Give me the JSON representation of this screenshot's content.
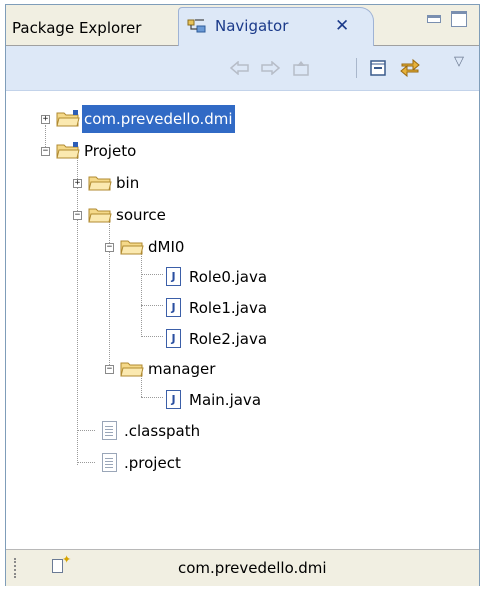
{
  "tabs": {
    "package_explorer": "Package Explorer",
    "navigator": "Navigator",
    "navigator_close": "✕"
  },
  "toolbar": {
    "back_icon": "back-arrow-icon",
    "forward_icon": "forward-arrow-icon",
    "up_icon": "go-up-icon",
    "collapse_icon": "collapse-all-icon",
    "link_icon": "link-with-editor-icon",
    "menu_icon": "view-menu-chevron-icon"
  },
  "tree": {
    "project1": "com.prevedello.dmi",
    "project2": "Projeto",
    "bin": "bin",
    "source": "source",
    "dmi0": "dMI0",
    "role0": "Role0.java",
    "role1": "Role1.java",
    "role2": "Role2.java",
    "manager": "manager",
    "main": "Main.java",
    "classpath": ".classpath",
    "project_file": ".project"
  },
  "status": {
    "text": "com.prevedello.dmi"
  },
  "colors": {
    "selection": "#316ac5",
    "tab_active": "#dde8f7",
    "chrome": "#f1efe2",
    "border": "#7f9db9"
  }
}
